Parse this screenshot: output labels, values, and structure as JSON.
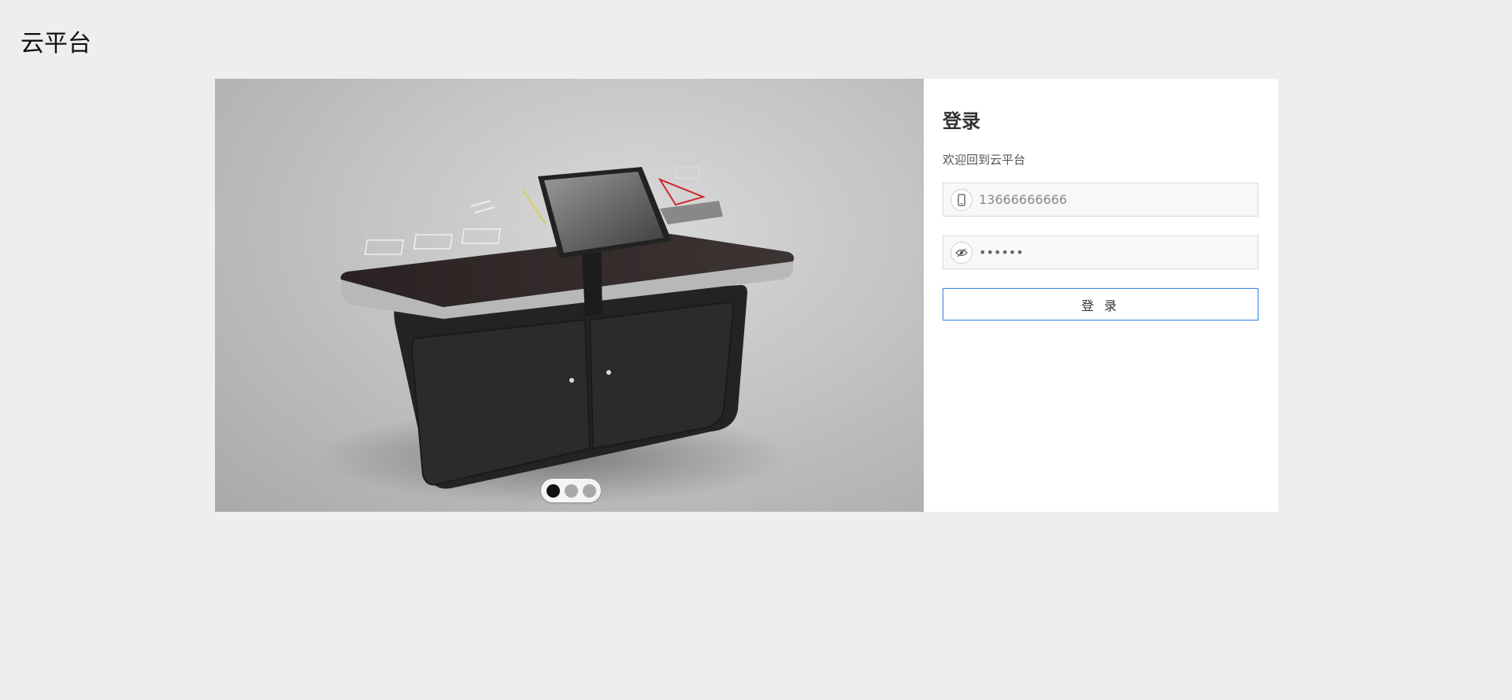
{
  "header": {
    "title": "云平台"
  },
  "carousel": {
    "slide_count": 3,
    "active_index": 0
  },
  "login": {
    "title": "登录",
    "welcome": "欢迎回到云平台",
    "phone_placeholder": "13666666666",
    "phone_icon": "mobile-phone-icon",
    "password_value": "666666",
    "password_icon": "eye-slash-icon",
    "submit_label": "登 录"
  },
  "colors": {
    "page_background": "#eeeeee",
    "button_border": "#3a84e2"
  }
}
